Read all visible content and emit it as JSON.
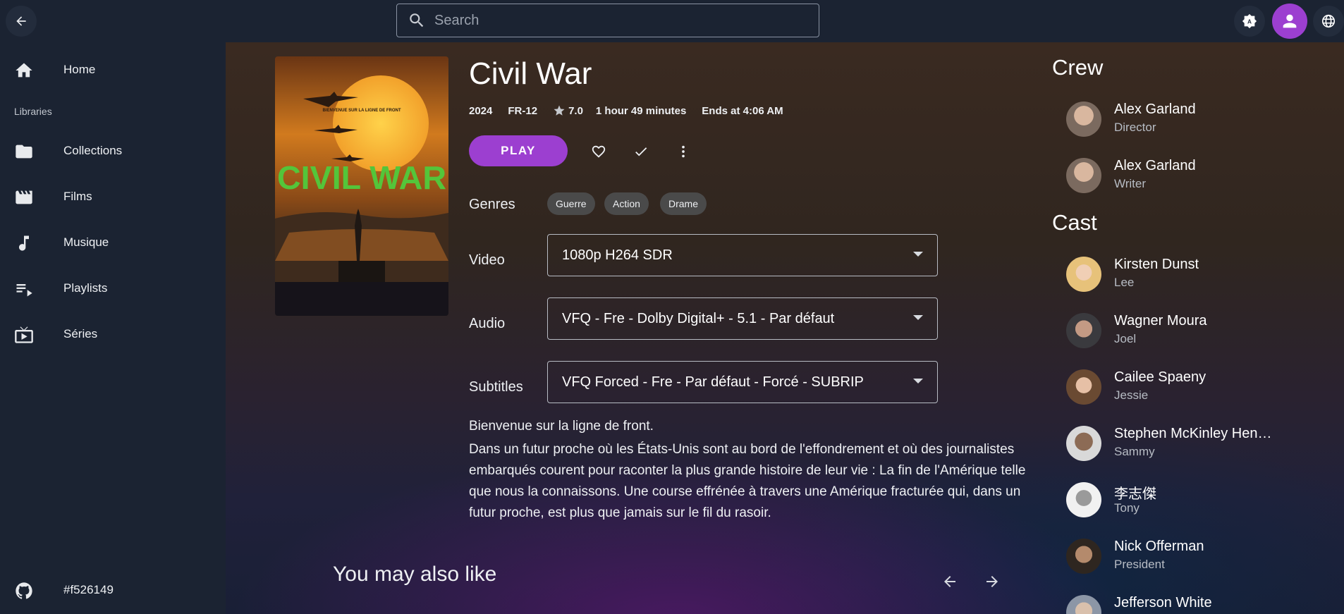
{
  "header": {
    "search": {
      "placeholder": "Search",
      "value": ""
    }
  },
  "sidebar": {
    "section_label": "Libraries",
    "items": [
      {
        "label": "Home",
        "icon": "home-icon"
      },
      {
        "label": "Collections",
        "icon": "folder-icon"
      },
      {
        "label": "Films",
        "icon": "movie-icon"
      },
      {
        "label": "Musique",
        "icon": "music-icon"
      },
      {
        "label": "Playlists",
        "icon": "playlist-icon"
      },
      {
        "label": "Séries",
        "icon": "tv-icon"
      }
    ],
    "footer": {
      "label": "#f526149",
      "icon": "github-icon"
    }
  },
  "movie": {
    "title": "Civil War",
    "poster_text": "CIVIL WAR",
    "poster_tagline": "BIENVENUE SUR LA LIGNE DE FRONT",
    "year": "2024",
    "rating_cert": "FR-12",
    "community_rating": "7.0",
    "runtime": "1 hour 49 minutes",
    "ends_at": "Ends at 4:06 AM",
    "play_label": "PLAY",
    "genres_label": "Genres",
    "genres": [
      "Guerre",
      "Action",
      "Drame"
    ],
    "video_label": "Video",
    "video_value": "1080p H264 SDR",
    "audio_label": "Audio",
    "audio_value": "VFQ - Fre - Dolby Digital+ - 5.1 - Par défaut",
    "subtitles_label": "Subtitles",
    "subtitles_value": "VFQ Forced - Fre - Par défaut - Forcé - SUBRIP",
    "tagline": "Bienvenue sur la ligne de front.",
    "overview": "Dans un futur proche où les États-Unis sont au bord de l'effondrement et où des journalistes embarqués courent pour raconter la plus grande histoire de leur vie : La fin de l'Amérique telle que nous la connaissons. Une course effrénée à travers une Amérique fracturée qui, dans un futur proche, est plus que jamais sur le fil du rasoir.",
    "also_like": "You may also like"
  },
  "crew": {
    "heading": "Crew",
    "people": [
      {
        "name": "Alex Garland",
        "role": "Director"
      },
      {
        "name": "Alex Garland",
        "role": "Writer"
      }
    ]
  },
  "cast": {
    "heading": "Cast",
    "people": [
      {
        "name": "Kirsten Dunst",
        "role": "Lee"
      },
      {
        "name": "Wagner Moura",
        "role": "Joel"
      },
      {
        "name": "Cailee Spaeny",
        "role": "Jessie"
      },
      {
        "name": "Stephen McKinley Hen…",
        "role": "Sammy"
      },
      {
        "name": "李志傑",
        "role": "Tony"
      },
      {
        "name": "Nick Offerman",
        "role": "President"
      },
      {
        "name": "Jefferson White",
        "role": ""
      }
    ]
  },
  "colors": {
    "accent": "#9c3fd0",
    "background": "#1b2332",
    "chip": "#4a4a4a"
  }
}
